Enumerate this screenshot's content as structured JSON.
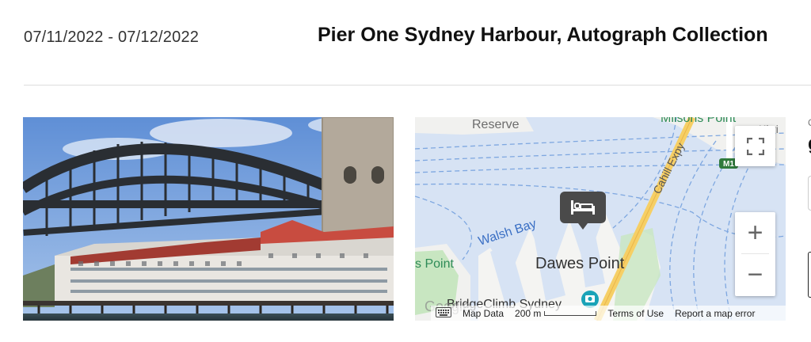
{
  "header": {
    "dates": "07/11/2022 - 07/12/2022",
    "hotel_name": "Pier One Sydney Harbour, Autograph Collection"
  },
  "map": {
    "labels": {
      "reserve": "Reserve",
      "milsons_point": "Milsons Point",
      "kirribilli": "Kirri",
      "m1": "M1",
      "cahill_expy": "Cahill Expy",
      "walsh_bay": "Walsh Bay",
      "dawes_point": "Dawes Point",
      "s_point": "s Point",
      "bridgeclimb": "BridgeClimb Sydney",
      "google": "Google"
    },
    "footer": {
      "keyboard_icon": "keyboard-icon",
      "map_data": "Map Data",
      "scale": "200 m",
      "terms": "Terms of Use",
      "report": "Report a map error"
    },
    "controls": {
      "zoom_in": "+",
      "zoom_out": "−"
    },
    "colors": {
      "water": "#d7e3f4",
      "land": "#f4f4f4",
      "road": "#f6cf65",
      "park": "#c8e6c1"
    }
  },
  "side": {
    "small_text": "C",
    "big_text": "g"
  }
}
